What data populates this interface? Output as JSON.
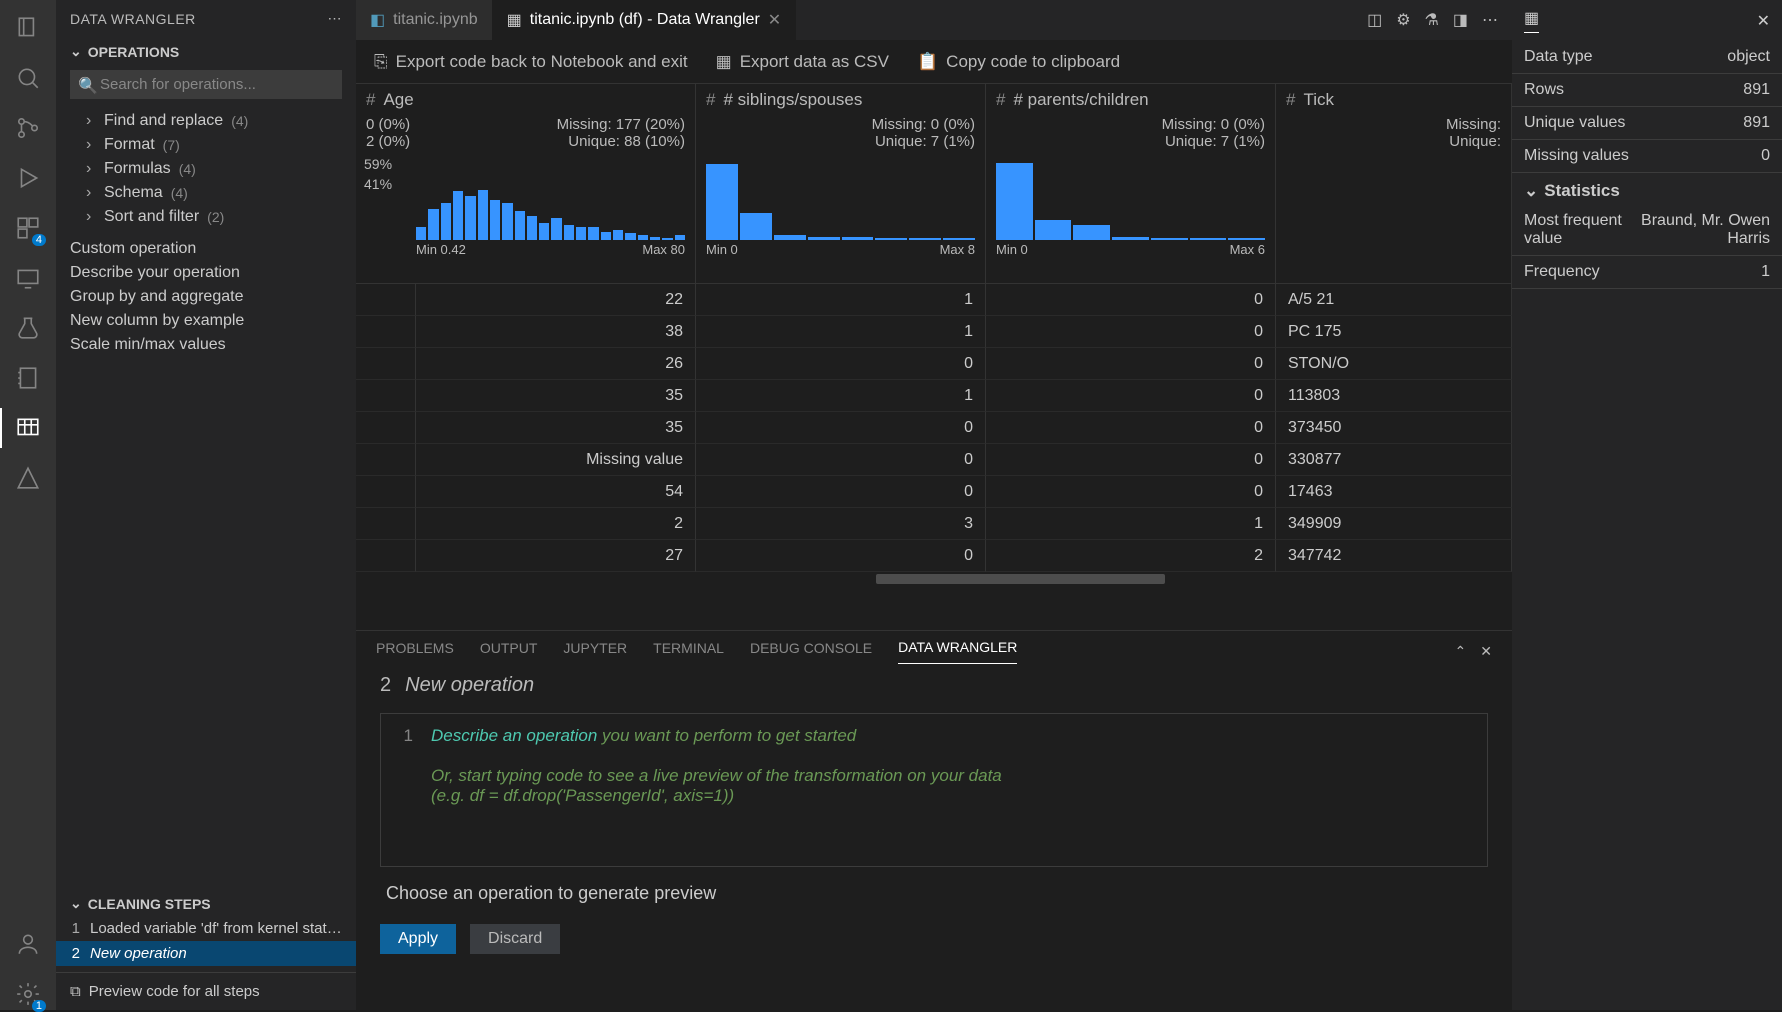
{
  "sidebar": {
    "title": "DATA WRANGLER",
    "operations_title": "OPERATIONS",
    "search_placeholder": "Search for operations...",
    "categories": [
      {
        "label": "Find and replace",
        "count": "(4)"
      },
      {
        "label": "Format",
        "count": "(7)"
      },
      {
        "label": "Formulas",
        "count": "(4)"
      },
      {
        "label": "Schema",
        "count": "(4)"
      },
      {
        "label": "Sort and filter",
        "count": "(2)"
      }
    ],
    "items": [
      "Custom operation",
      "Describe your operation",
      "Group by and aggregate",
      "New column by example",
      "Scale min/max values"
    ],
    "cleaning_title": "CLEANING STEPS",
    "cleaning_steps": [
      {
        "n": "1",
        "label": "Loaded variable 'df' from kernel stat…"
      },
      {
        "n": "2",
        "label": "New operation"
      }
    ],
    "preview_steps": "Preview code for all steps"
  },
  "tabs": [
    {
      "label": "titanic.ipynb",
      "active": false
    },
    {
      "label": "titanic.ipynb (df) - Data Wrangler",
      "active": true
    }
  ],
  "toolbar": {
    "export_nb": "Export code back to Notebook and exit",
    "export_csv": "Export data as CSV",
    "copy": "Copy code to clipboard"
  },
  "columns": [
    {
      "name": "Age",
      "left_a": "0 (0%)",
      "left_b": "2 (0%)",
      "miss": "177 (20%)",
      "uniq": "88 (10%)",
      "min": "Min 0.42",
      "max": "Max 80"
    },
    {
      "name": "# siblings/spouses",
      "left_a": "",
      "left_b": "",
      "miss": "0 (0%)",
      "uniq": "7 (1%)",
      "min": "Min 0",
      "max": "Max 8"
    },
    {
      "name": "# parents/children",
      "left_a": "",
      "left_b": "",
      "miss": "0 (0%)",
      "uniq": "7 (1%)",
      "min": "Min 0",
      "max": "Max 6"
    },
    {
      "name": "Tick",
      "left_a": "",
      "left_b": "",
      "miss": "",
      "uniq": "",
      "min": "",
      "max": ""
    }
  ],
  "miss_label": "Missing:",
  "uniq_label": "Unique:",
  "hist_y": [
    "59%",
    "41%"
  ],
  "chart_data": [
    {
      "type": "bar",
      "title": "Age",
      "xlabel": "",
      "ylabel": "",
      "min_label": "Min 0.42",
      "max_label": "Max 80",
      "ylim_percent": [
        0,
        60
      ],
      "y_ticks": [
        "59%",
        "41%"
      ],
      "values_pct": [
        15,
        37,
        44,
        58,
        52,
        60,
        48,
        44,
        35,
        28,
        20,
        26,
        18,
        15,
        16,
        10,
        12,
        8,
        6,
        4,
        2,
        6
      ]
    },
    {
      "type": "bar",
      "title": "# siblings/spouses",
      "xlabel": "",
      "ylabel": "",
      "min_label": "Min 0",
      "max_label": "Max 8",
      "values_pct": [
        90,
        32,
        6,
        4,
        4,
        2,
        2,
        2
      ]
    },
    {
      "type": "bar",
      "title": "# parents/children",
      "xlabel": "",
      "ylabel": "",
      "min_label": "Min 0",
      "max_label": "Max 6",
      "values_pct": [
        92,
        24,
        18,
        4,
        2,
        2,
        2
      ]
    }
  ],
  "rows": [
    {
      "age": "22",
      "sib": "1",
      "par": "0",
      "tick": "A/5 21"
    },
    {
      "age": "38",
      "sib": "1",
      "par": "0",
      "tick": "PC 175"
    },
    {
      "age": "26",
      "sib": "0",
      "par": "0",
      "tick": "STON/O"
    },
    {
      "age": "35",
      "sib": "1",
      "par": "0",
      "tick": "113803"
    },
    {
      "age": "35",
      "sib": "0",
      "par": "0",
      "tick": "373450"
    },
    {
      "age": "Missing value",
      "sib": "0",
      "par": "0",
      "tick": "330877"
    },
    {
      "age": "54",
      "sib": "0",
      "par": "0",
      "tick": "17463"
    },
    {
      "age": "2",
      "sib": "3",
      "par": "1",
      "tick": "349909"
    },
    {
      "age": "27",
      "sib": "0",
      "par": "2",
      "tick": "347742"
    }
  ],
  "panel_tabs": [
    "PROBLEMS",
    "OUTPUT",
    "JUPYTER",
    "TERMINAL",
    "DEBUG CONSOLE",
    "DATA WRANGLER"
  ],
  "new_op": {
    "n": "2",
    "title": "New operation"
  },
  "editor": {
    "line_no": "1",
    "l1_hl": "Describe an operation",
    "l1_rest": " you want to perform to get started",
    "l2": "Or, start typing code to see a live preview of the transformation on your data",
    "l3": "(e.g. df = df.drop('PassengerId', axis=1))"
  },
  "preview_msg": "Choose an operation to generate preview",
  "buttons": {
    "apply": "Apply",
    "discard": "Discard"
  },
  "right": {
    "dtype_k": "Data type",
    "dtype_v": "object",
    "rows_k": "Rows",
    "rows_v": "891",
    "uniq_k": "Unique values",
    "uniq_v": "891",
    "miss_k": "Missing values",
    "miss_v": "0",
    "stats": "Statistics",
    "mfv_k": "Most frequent value",
    "mfv_v": "Braund, Mr. Owen Harris",
    "freq_k": "Frequency",
    "freq_v": "1"
  },
  "activity_badges": {
    "ext": "4",
    "settings": "1"
  }
}
